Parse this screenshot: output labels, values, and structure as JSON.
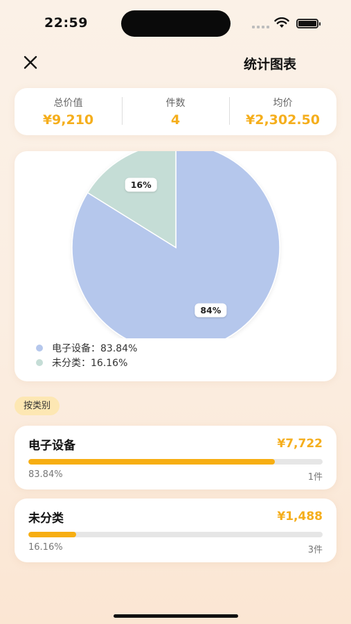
{
  "status_bar": {
    "time": "22:59"
  },
  "nav": {
    "title": "统计图表"
  },
  "summary": [
    {
      "label": "总价值",
      "value": "¥9,210"
    },
    {
      "label": "件数",
      "value": "4"
    },
    {
      "label": "均价",
      "value": "¥2,302.50"
    }
  ],
  "chart_data": {
    "type": "pie",
    "slices": [
      {
        "name": "电子设备",
        "value": 83.84,
        "label": "84%",
        "color": "#b5c7ec"
      },
      {
        "name": "未分类",
        "value": 16.16,
        "label": "16%",
        "color": "#c5ddd6"
      }
    ],
    "legend": [
      "电子设备：83.84%",
      "未分类：16.16%"
    ]
  },
  "section_tag": "按类别",
  "categories": [
    {
      "name": "电子设备",
      "amount": "¥7,722",
      "percent_text": "83.84%",
      "count": "1件",
      "ratio": 0.8384
    },
    {
      "name": "未分类",
      "amount": "¥1,488",
      "percent_text": "16.16%",
      "count": "3件",
      "ratio": 0.1616
    }
  ],
  "colors": {
    "accent": "#f5ae1c",
    "bar": "#f7ae12"
  }
}
